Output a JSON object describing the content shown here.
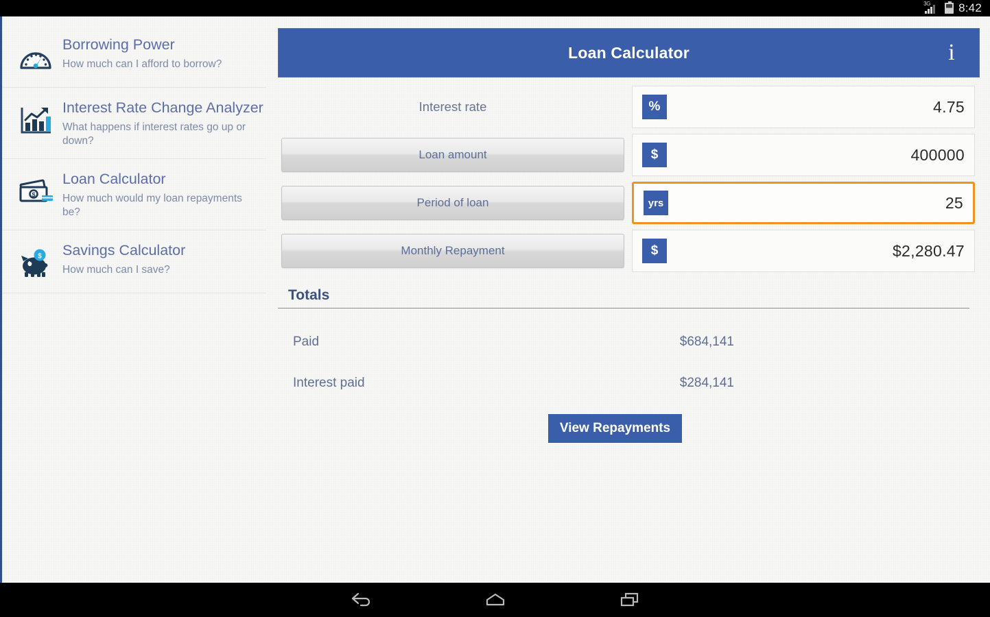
{
  "status_bar": {
    "network_label": "3G",
    "time": "8:42",
    "signal_icon": "signal-bars-icon",
    "battery_icon": "battery-icon"
  },
  "sidebar": {
    "items": [
      {
        "icon": "speedometer-icon",
        "title": "Borrowing Power",
        "subtitle": "How much can I afford to borrow?"
      },
      {
        "icon": "bar-chart-trend-icon",
        "title": "Interest Rate Change Analyzer",
        "subtitle": "What happens if interest rates go up or down?"
      },
      {
        "icon": "banknotes-icon",
        "title": "Loan Calculator",
        "subtitle": "How much would my loan repayments be?"
      },
      {
        "icon": "piggy-bank-icon",
        "title": "Savings Calculator",
        "subtitle": "How much can I save?"
      }
    ]
  },
  "header": {
    "title": "Loan Calculator",
    "info_icon": "info-icon",
    "background_color": "#3b5eab"
  },
  "form": {
    "rows": [
      {
        "label": "Interest rate",
        "is_button": false,
        "badge": "%",
        "value": "4.75",
        "focused": false
      },
      {
        "label": "Loan amount",
        "is_button": true,
        "badge": "$",
        "value": "400000",
        "focused": false
      },
      {
        "label": "Period of loan",
        "is_button": true,
        "badge": "yrs",
        "value": "25",
        "focused": true
      },
      {
        "label": "Monthly Repayment",
        "is_button": true,
        "badge": "$",
        "value": "$2,280.47",
        "focused": false
      }
    ]
  },
  "totals": {
    "heading": "Totals",
    "rows": [
      {
        "label": "Paid",
        "value": "$684,141"
      },
      {
        "label": "Interest paid",
        "value": "$284,141"
      }
    ],
    "cta_label": "View Repayments"
  },
  "nav_bar": {
    "back_icon": "back-arrow-icon",
    "home_icon": "home-icon",
    "recents_icon": "recent-apps-icon"
  },
  "colors": {
    "accent_blue": "#3b5eab",
    "focus_orange": "#f0921f",
    "sidebar_title": "#5c6ea8",
    "page_background": "#f7f7f5"
  }
}
